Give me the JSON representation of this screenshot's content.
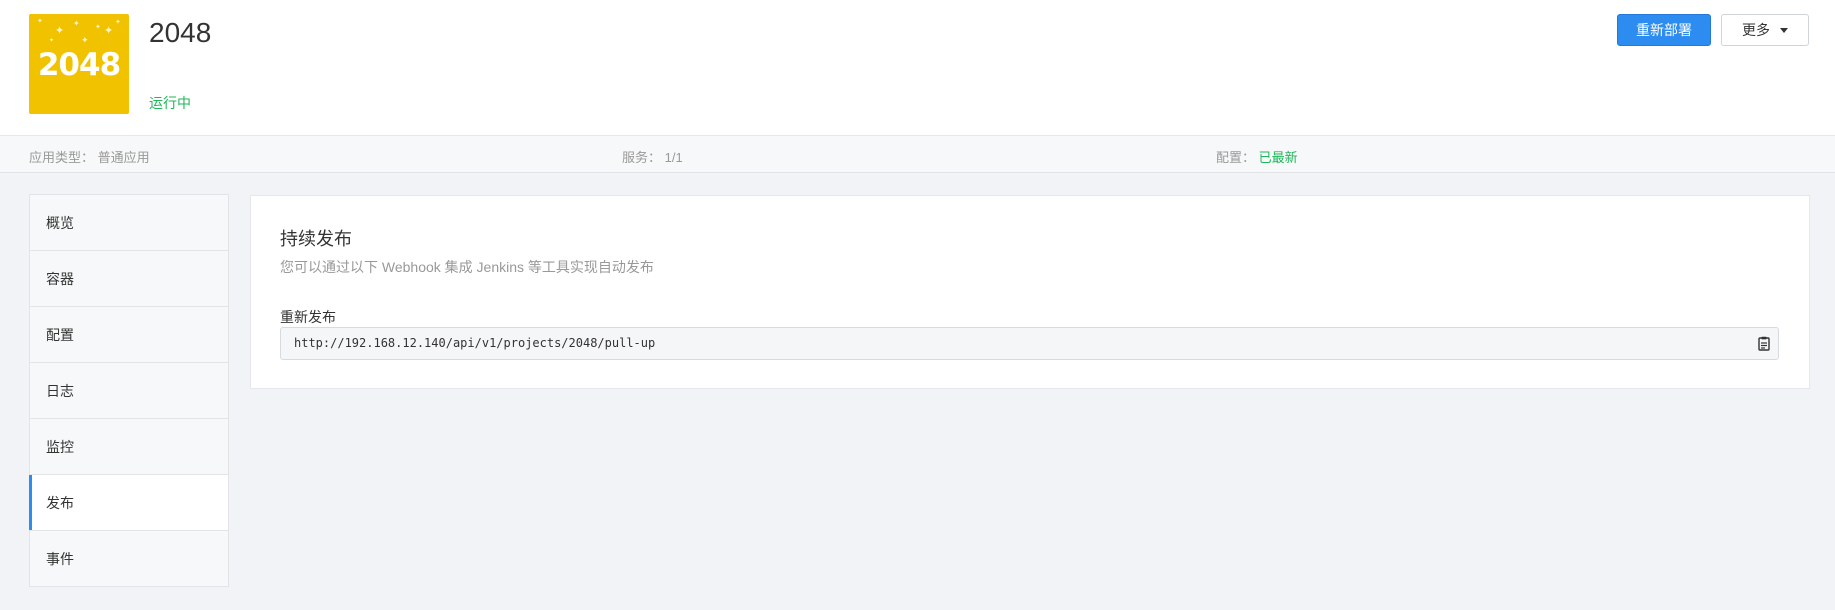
{
  "app": {
    "logo_text": "2048",
    "name": "2048",
    "status": "运行中",
    "brand_color": "#f0c200",
    "status_color": "#1fb65a"
  },
  "actions": {
    "redeploy_label": "重新部署",
    "more_label": "更多",
    "primary_color": "#2d8cf0"
  },
  "info": {
    "type_label": "应用类型：",
    "type_value": "普通应用",
    "service_label": "服务：",
    "service_value": "1/1",
    "config_label": "配置：",
    "config_value": "已最新"
  },
  "sidebar": {
    "items": [
      {
        "label": "概览",
        "active": false
      },
      {
        "label": "容器",
        "active": false
      },
      {
        "label": "配置",
        "active": false
      },
      {
        "label": "日志",
        "active": false
      },
      {
        "label": "监控",
        "active": false
      },
      {
        "label": "发布",
        "active": true
      },
      {
        "label": "事件",
        "active": false
      }
    ]
  },
  "main": {
    "title": "持续发布",
    "description": "您可以通过以下 Webhook 集成 Jenkins 等工具实现自动发布",
    "field_label": "重新发布",
    "url": "http://192.168.12.140/api/v1/projects/2048/pull-up",
    "copy_icon": "clipboard-icon"
  }
}
